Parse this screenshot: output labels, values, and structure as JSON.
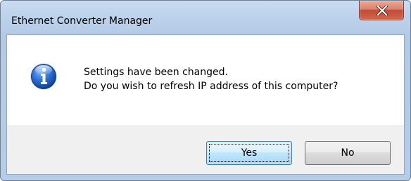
{
  "window": {
    "title": "Ethernet Converter Manager"
  },
  "dialog": {
    "icon": "info-icon",
    "message_line1": "Settings have been changed.",
    "message_line2": "Do you wish to refresh IP address of this computer?"
  },
  "buttons": {
    "yes_label": "Yes",
    "no_label": "No",
    "no_mnemonic": "N"
  },
  "colors": {
    "title_bar": "#bed3ec",
    "close_button": "#c44b33",
    "info_icon": "#1f5fbf",
    "default_button_border": "#3c7fb1",
    "footer": "#f0f0f0"
  }
}
